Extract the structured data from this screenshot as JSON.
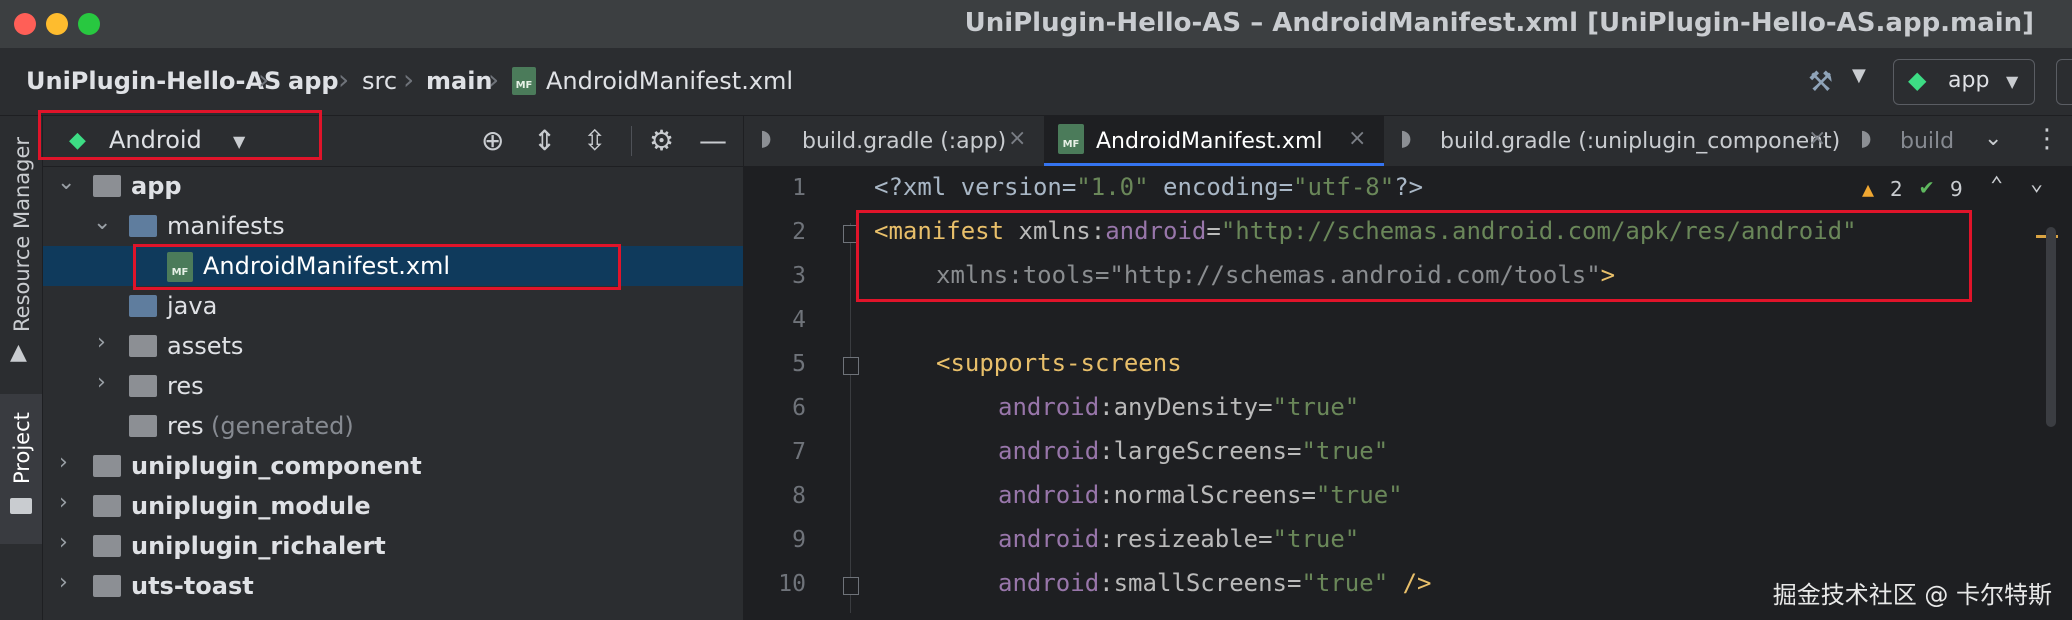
{
  "window": {
    "title": "UniPlugin-Hello-AS – AndroidManifest.xml [UniPlugin-Hello-AS.app.main]"
  },
  "breadcrumb": [
    "UniPlugin-Hello-AS",
    "app",
    "src",
    "main",
    "AndroidManifest.xml"
  ],
  "run_config": {
    "label": "app"
  },
  "side_stripe": {
    "resource_manager": "Resource Manager",
    "project": "Project"
  },
  "project_panel": {
    "view_selector": "Android",
    "tree": [
      {
        "label": "app"
      },
      {
        "label": "manifests"
      },
      {
        "label": "AndroidManifest.xml",
        "icon_text": "MF"
      },
      {
        "label": "java"
      },
      {
        "label": "assets"
      },
      {
        "label": "res"
      },
      {
        "label": "res",
        "suffix": "(generated)"
      },
      {
        "label": "uniplugin_component"
      },
      {
        "label": "uniplugin_module"
      },
      {
        "label": "uniplugin_richalert"
      },
      {
        "label": "uts-toast"
      }
    ]
  },
  "editor_tabs": [
    {
      "label": "build.gradle (:app)"
    },
    {
      "label": "AndroidManifest.xml",
      "icon_text": "MF"
    },
    {
      "label": "build.gradle (:uniplugin_component)"
    },
    {
      "label": "build"
    }
  ],
  "inspections": {
    "warnings": "2",
    "checks": "9"
  },
  "editor": {
    "line_numbers": [
      "1",
      "2",
      "3",
      "4",
      "5",
      "6",
      "7",
      "8",
      "9",
      "10"
    ],
    "line1": {
      "a": "<?xml version=",
      "b": "\"1.0\"",
      "c": " encoding=",
      "d": "\"utf-8\"",
      "e": "?>"
    },
    "line2": {
      "a": "<manifest",
      "b": " xmlns:",
      "c": "android",
      "d": "=",
      "e": "\"http://schemas.android.com/apk/res/android\""
    },
    "line3": {
      "a": "xmlns:tools=\"http://schemas.android.com/tools\"",
      "b": ">"
    },
    "line5": {
      "a": "<supports-screens"
    },
    "attrs": [
      {
        "ns": "android",
        "name": ":anyDensity=",
        "val": "\"true\""
      },
      {
        "ns": "android",
        "name": ":largeScreens=",
        "val": "\"true\""
      },
      {
        "ns": "android",
        "name": ":normalScreens=",
        "val": "\"true\""
      },
      {
        "ns": "android",
        "name": ":resizeable=",
        "val": "\"true\""
      },
      {
        "ns": "android",
        "name": ":smallScreens=",
        "val": "\"true\"",
        "tail": " />"
      }
    ]
  },
  "watermark": "掘金技术社区 @ 卡尔特斯",
  "colors": {
    "highlight_box": "#e0142a",
    "selection": "#0f3a5c",
    "tag": "#e8bf6a",
    "namespace": "#9876aa",
    "string": "#6a8759"
  }
}
